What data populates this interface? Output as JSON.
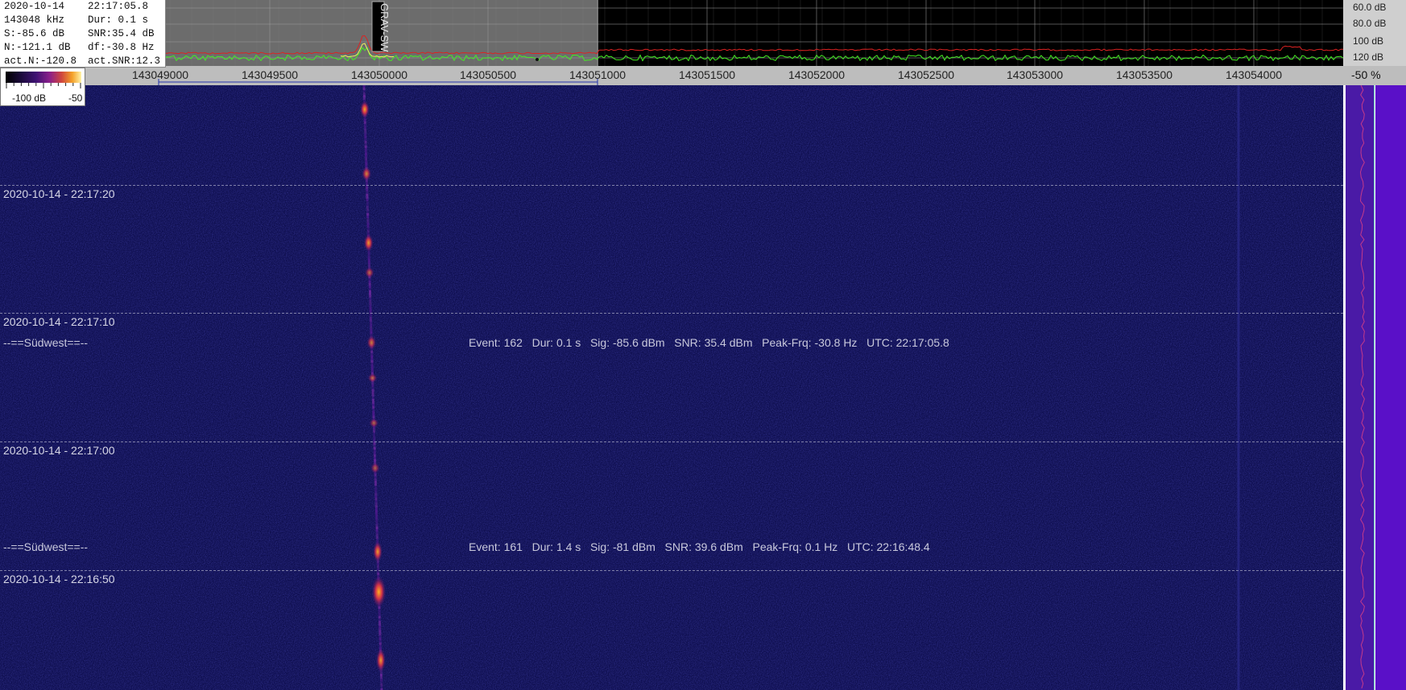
{
  "info_box": {
    "rows": [
      {
        "left": "2020-10-14",
        "right": "22:17:05.8"
      },
      {
        "left": "143048 kHz",
        "right": "Dur: 0.1 s"
      },
      {
        "left": "S:-85.6 dB",
        "right": "SNR:35.4 dB"
      },
      {
        "left": "N:-121.1 dB",
        "right": "df:-30.8 Hz"
      },
      {
        "left": "act.N:-120.8",
        "right": "act.SNR:12.3"
      }
    ]
  },
  "spectrum": {
    "db_labels": [
      "60.0 dB",
      "80.0 dB",
      "100 dB",
      "120 dB"
    ],
    "marker_label": "GRAV-SW",
    "colors": {
      "selected_bg": "#6c6c6c",
      "unselected_bg": "#000000",
      "trace": "#44ee22",
      "peak_trace": "#dd2222",
      "grid": "#9a9a9a"
    }
  },
  "freq_axis": {
    "unit": "Hz",
    "ticks": [
      "143049000",
      "143049500",
      "143050000",
      "143050500",
      "143051000",
      "143051500",
      "143052000",
      "143052500",
      "143053000",
      "143053500",
      "143054000"
    ],
    "percent_label": "-50 %"
  },
  "color_legend": {
    "min_label": "-100 dB",
    "max_label": "-50"
  },
  "waterfall": {
    "background": "#0e0e4e",
    "timestamps": [
      "2020-10-14 - 22:17:20",
      "2020-10-14 - 22:17:10",
      "2020-10-14 - 22:17:00",
      "2020-10-14 - 22:16:50"
    ],
    "events": [
      {
        "direction": "--==Südwest==--",
        "text": "Event: 162   Dur: 0.1 s   Sig: -85.6 dBm   SNR: 35.4 dBm   Peak-Frq: -30.8 Hz   UTC: 22:17:05.8"
      },
      {
        "direction": "--==Südwest==--",
        "text": "Event: 161   Dur: 1.4 s   Sig: -81 dBm   SNR: 39.6 dBm   Peak-Frq: 0.1 Hz   UTC: 22:16:48.4"
      }
    ]
  }
}
